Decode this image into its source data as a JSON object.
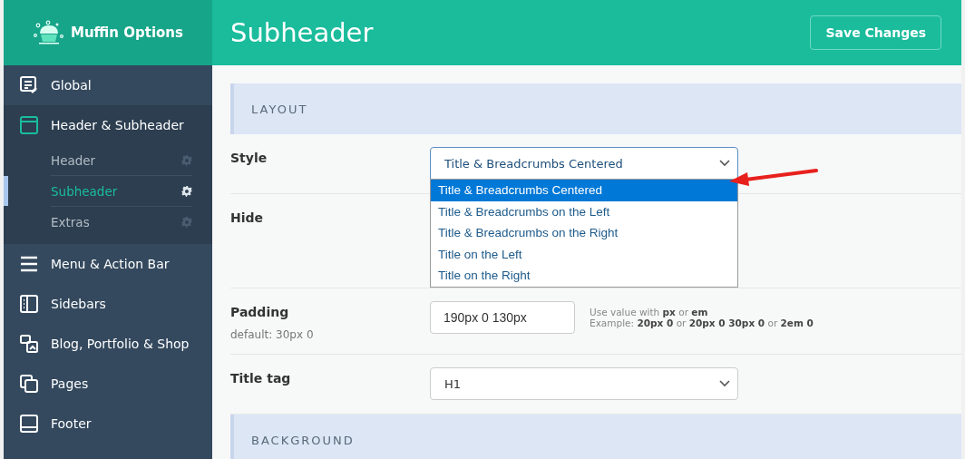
{
  "logo": {
    "title": "Muffin Options"
  },
  "sidebar": {
    "items": [
      {
        "label": "Global",
        "expanded": false
      },
      {
        "label": "Header & Subheader",
        "expanded": true,
        "children": [
          {
            "label": "Header",
            "selected": false
          },
          {
            "label": "Subheader",
            "selected": true
          },
          {
            "label": "Extras",
            "selected": false
          }
        ]
      },
      {
        "label": "Menu & Action Bar",
        "expanded": false
      },
      {
        "label": "Sidebars",
        "expanded": false
      },
      {
        "label": "Blog, Portfolio & Shop",
        "expanded": false
      },
      {
        "label": "Pages",
        "expanded": false
      },
      {
        "label": "Footer",
        "expanded": false
      }
    ]
  },
  "header": {
    "title": "Subheader",
    "save_button": "Save Changes"
  },
  "sections": [
    {
      "title": "LAYOUT",
      "rows": [
        {
          "kind": "select",
          "label": "Style",
          "value": "Title & Breadcrumbs Centered",
          "open": true,
          "options": [
            {
              "label": "Title & Breadcrumbs Centered",
              "selected": true
            },
            {
              "label": "Title & Breadcrumbs on the Left",
              "selected": false
            },
            {
              "label": "Title & Breadcrumbs on the Right",
              "selected": false
            },
            {
              "label": "Title on the Left",
              "selected": false
            },
            {
              "label": "Title on the Right",
              "selected": false
            }
          ]
        },
        {
          "kind": "empty",
          "label": "Hide"
        },
        {
          "kind": "text",
          "label": "Padding",
          "description": "default: 30px 0",
          "value": "190px 0 130px",
          "hint": [
            "Use value with **px** or **em**",
            "Example: **20px 0** or **20px 0 30px 0** or **2em 0**"
          ]
        },
        {
          "kind": "select",
          "label": "Title tag",
          "value": "H1",
          "open": false
        }
      ]
    },
    {
      "title": "BACKGROUND"
    }
  ]
}
